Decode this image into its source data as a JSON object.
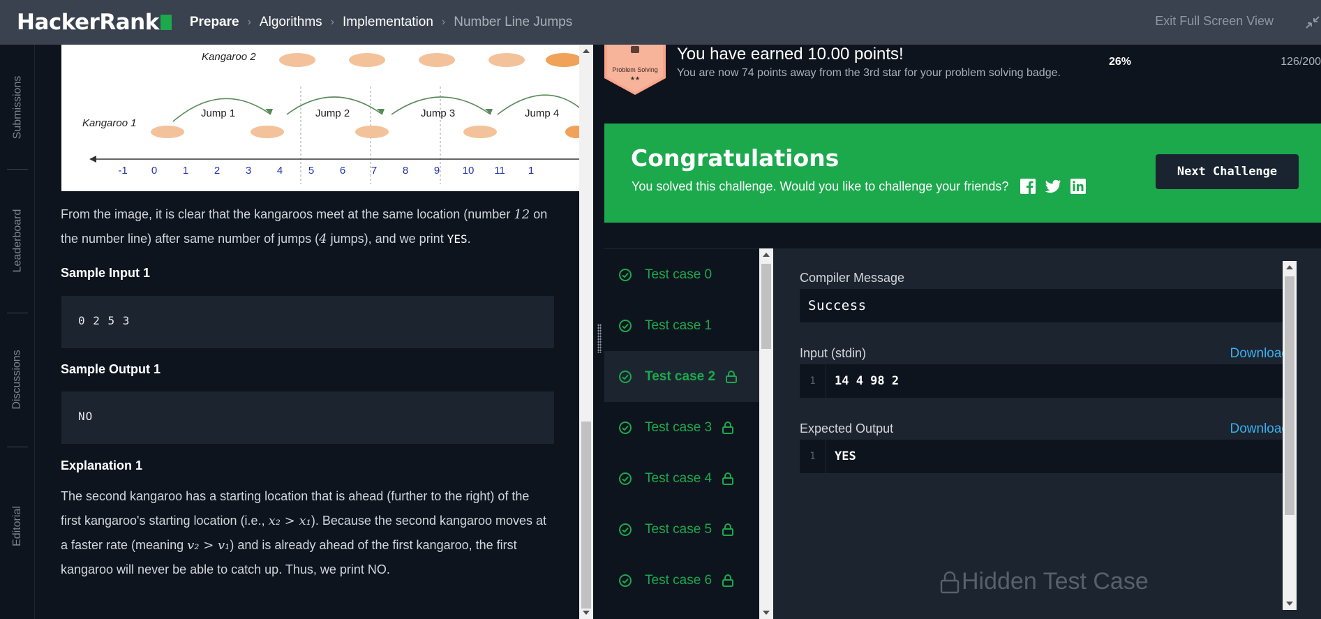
{
  "header": {
    "logo_text": "HackerRank",
    "breadcrumbs": [
      "Prepare",
      "Algorithms",
      "Implementation",
      "Number Line Jumps"
    ],
    "exit_fullscreen": "Exit Full Screen View"
  },
  "side_nav": [
    "Submissions",
    "Leaderboard",
    "Discussions",
    "Editorial"
  ],
  "problem": {
    "diagram": {
      "kangaroo2": "Kangaroo 2",
      "kangaroo1": "Kangaroo 1",
      "jumps": [
        "Jump 1",
        "Jump 2",
        "Jump 3",
        "Jump 4"
      ],
      "numbers": [
        "-1",
        "0",
        "1",
        "2",
        "3",
        "4",
        "5",
        "6",
        "7",
        "8",
        "9",
        "10",
        "11",
        "1"
      ]
    },
    "explain0_part1": "From the image, it is clear that the kangaroos meet at the same location (number ",
    "explain0_num": "12",
    "explain0_part2": " on the number line) after same number of jumps (",
    "explain0_jumps": "4",
    "explain0_part3": " jumps), and we print ",
    "explain0_code": "YES",
    "explain0_end": ".",
    "sample_input_title": "Sample Input 1",
    "sample_input": "0 2 5 3",
    "sample_output_title": "Sample Output 1",
    "sample_output": "NO",
    "explanation_title": "Explanation 1",
    "explain1_a": "The second kangaroo has a starting location that is ahead (further to the right) of the first kangaroo's starting location (i.e., ",
    "explain1_math1": "x₂ > x₁",
    "explain1_b": "). Because the second kangaroo moves at a faster rate (meaning ",
    "explain1_math2": "v₂ > v₁",
    "explain1_c": ") and is already ahead of the first kangaroo, the first kangaroo will never be able to catch up. Thus, we print NO."
  },
  "result": {
    "badge_text": "Problem Solving",
    "badge_stars": "★★",
    "earned_title": "You have earned 10.00 points!",
    "earned_sub": "You are now 74 points away from the 3rd star for your problem solving badge.",
    "percent": "26%",
    "score": "126/200",
    "congrats_title": "Congratulations",
    "congrats_text": "You solved this challenge. Would you like to challenge your friends?",
    "next_button": "Next Challenge",
    "test_cases": [
      {
        "label": "Test case 0",
        "locked": false,
        "active": false
      },
      {
        "label": "Test case 1",
        "locked": false,
        "active": false
      },
      {
        "label": "Test case 2",
        "locked": true,
        "active": true
      },
      {
        "label": "Test case 3",
        "locked": true,
        "active": false
      },
      {
        "label": "Test case 4",
        "locked": true,
        "active": false
      },
      {
        "label": "Test case 5",
        "locked": true,
        "active": false
      },
      {
        "label": "Test case 6",
        "locked": true,
        "active": false
      }
    ],
    "compiler_label": "Compiler Message",
    "compiler_message": "Success",
    "input_label": "Input (stdin)",
    "input_line": "1",
    "input_value": "14 4 98 2",
    "expected_label": "Expected Output",
    "expected_line": "1",
    "expected_value": "YES",
    "download_label": "Download",
    "hidden_label": "Hidden Test Case"
  },
  "colors": {
    "accent_green": "#1ba94c",
    "link_blue": "#39b1ee",
    "topbar": "#39424e"
  }
}
